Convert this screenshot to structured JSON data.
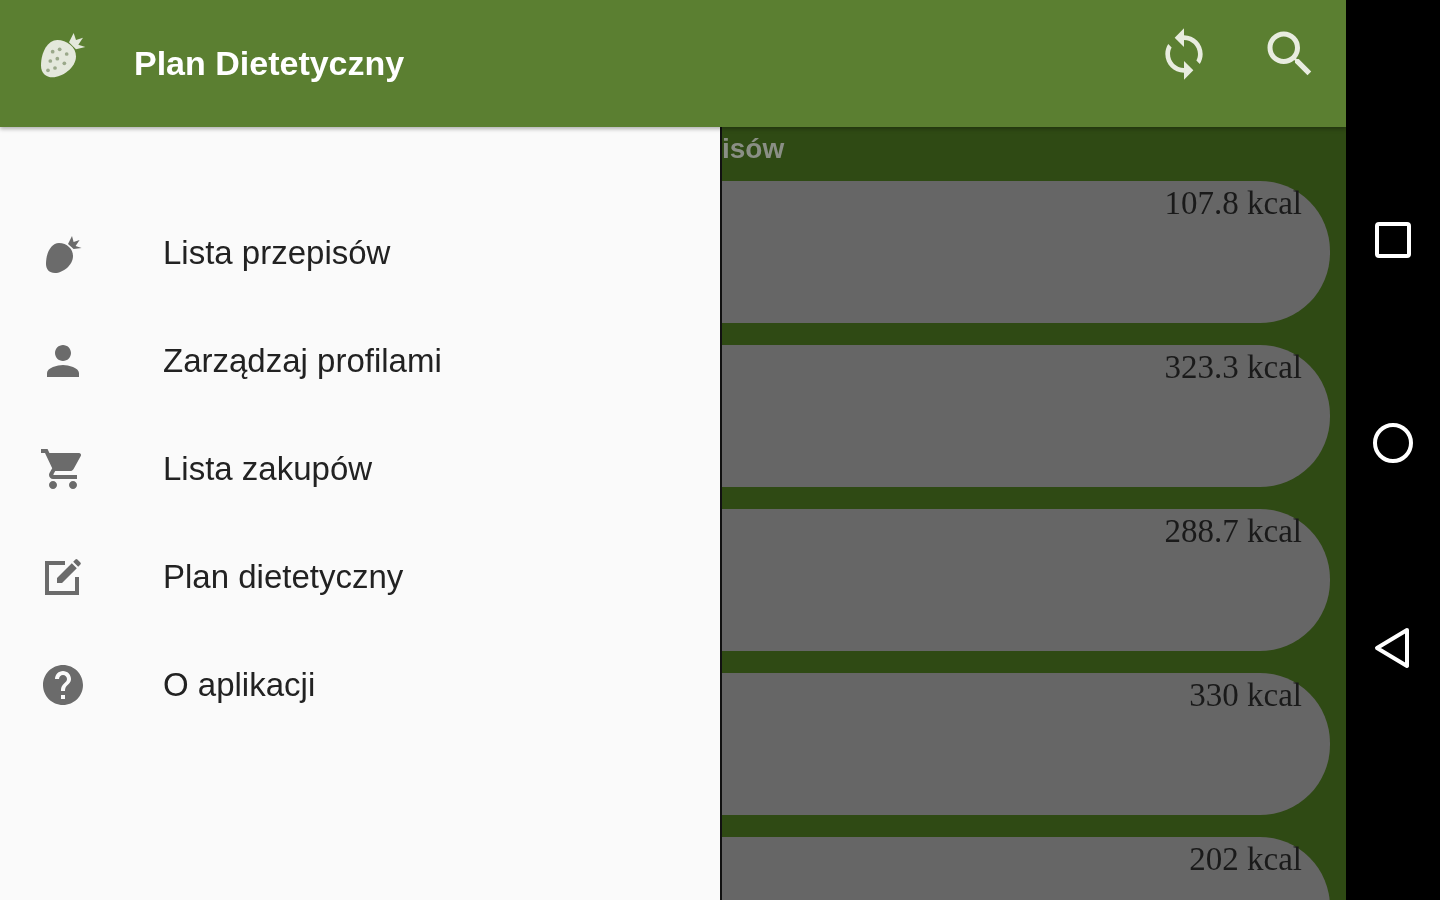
{
  "toolbar": {
    "title": "Plan Dietetyczny"
  },
  "drawer": {
    "items": [
      {
        "label": "Lista przepisów",
        "kind": "strawberry"
      },
      {
        "label": "Zarządzaj profilami",
        "kind": "person"
      },
      {
        "label": "Lista zakupów",
        "kind": "cart"
      },
      {
        "label": "Plan dietetyczny",
        "kind": "edit"
      },
      {
        "label": "O aplikacji",
        "kind": "help"
      }
    ]
  },
  "content": {
    "header": "isów",
    "cards": [
      {
        "calories": "107.8 kcal"
      },
      {
        "calories": "323.3 kcal"
      },
      {
        "calories": "288.7 kcal"
      },
      {
        "calories": "330 kcal"
      },
      {
        "calories": "202 kcal"
      }
    ]
  }
}
